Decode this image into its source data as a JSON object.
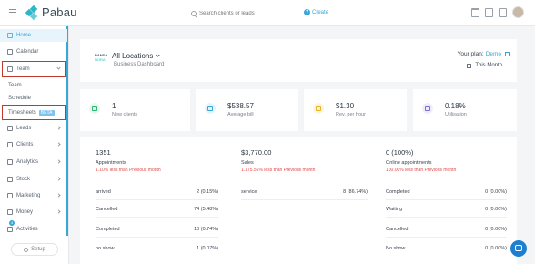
{
  "app": {
    "name": "Pabau"
  },
  "topbar": {
    "search_placeholder": "Search clients or leads",
    "create_label": "Create"
  },
  "sidebar": {
    "items": {
      "home": "Home",
      "calendar": "Calendar",
      "team": "Team",
      "team_sub": "Team",
      "schedule": "Schedule",
      "timesheets": "Timesheets",
      "beta": "BETA",
      "leads": "Leads",
      "clients": "Clients",
      "analytics": "Analytics",
      "stock": "Stock",
      "marketing": "Marketing",
      "money": "Money",
      "activities": "Activities",
      "activities_badge": "4"
    },
    "setup": "Setup"
  },
  "header": {
    "location_logo_line1": "BANDA",
    "location_logo_line2": "NORA",
    "location": "All Locations",
    "subtitle": "Business Dashboard",
    "plan_label": "Your plan:",
    "plan_name": "Demo",
    "period": "This Month"
  },
  "stats": [
    {
      "value": "1",
      "label": "New clients",
      "color": "#2bb673"
    },
    {
      "value": "$538.57",
      "label": "Average bill",
      "color": "#3aa6d6"
    },
    {
      "value": "$1.30",
      "label": "Rev. per hour",
      "color": "#e8b320"
    },
    {
      "value": "0.18%",
      "label": "Utilisation",
      "color": "#7a6fd0"
    }
  ],
  "columns": {
    "appointments": {
      "total": "1351",
      "label": "Appointments",
      "delta": "1.10% less than Previous month",
      "rows": [
        {
          "label": "arrived",
          "value": "2 (0.15%)"
        },
        {
          "label": "Cancelled",
          "value": "74 (5.48%)"
        },
        {
          "label": "Completed",
          "value": "10 (0.74%)"
        },
        {
          "label": "no show",
          "value": "1 (0.07%)"
        }
      ]
    },
    "sales": {
      "total": "$3,770.00",
      "label": "Sales",
      "delta": "1.175.56% less than Previous month",
      "rows": [
        {
          "label": "service",
          "value": "8 (86.74%)"
        }
      ]
    },
    "online": {
      "total": "0 (100%)",
      "label": "Online appointments",
      "delta": "100.00% less than Previous month",
      "rows": [
        {
          "label": "Completed",
          "value": "0 (0.00%)"
        },
        {
          "label": "Waiting",
          "value": "0 (0.00%)"
        },
        {
          "label": "Cancelled",
          "value": "0 (0.00%)"
        },
        {
          "label": "No show",
          "value": "0 (0.00%)"
        }
      ]
    }
  }
}
